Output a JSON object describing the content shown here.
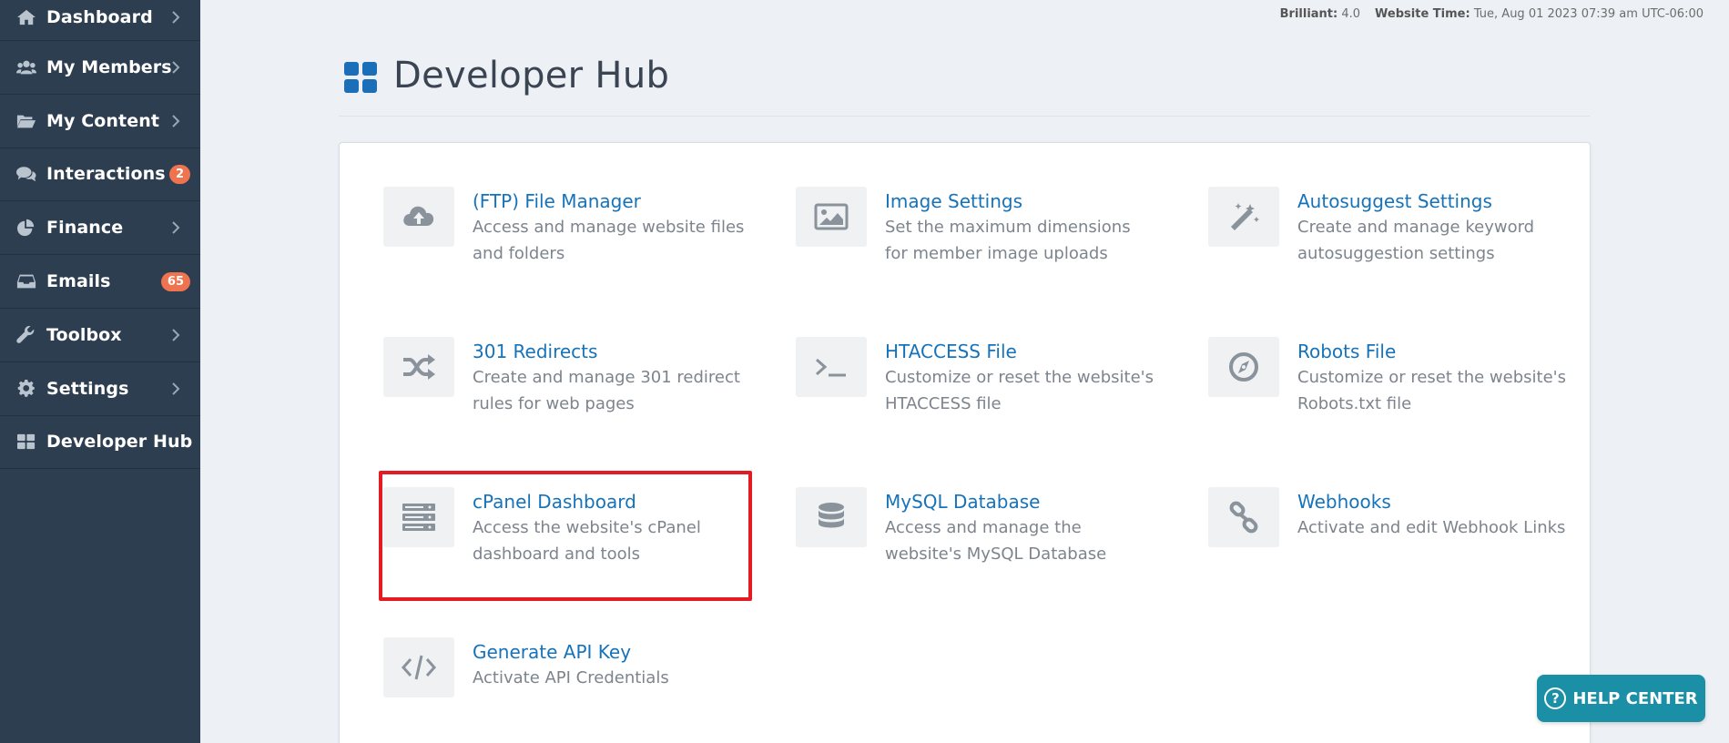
{
  "sidebar": {
    "items": [
      {
        "label": "Dashboard",
        "icon": "home-icon",
        "badge": null,
        "chevron": true
      },
      {
        "label": "My Members",
        "icon": "users-icon",
        "badge": null,
        "chevron": true
      },
      {
        "label": "My Content",
        "icon": "folder-open-icon",
        "badge": null,
        "chevron": true
      },
      {
        "label": "Interactions",
        "icon": "comments-icon",
        "badge": "2",
        "chevron": false
      },
      {
        "label": "Finance",
        "icon": "pie-chart-icon",
        "badge": null,
        "chevron": true
      },
      {
        "label": "Emails",
        "icon": "inbox-icon",
        "badge": "65",
        "chevron": false
      },
      {
        "label": "Toolbox",
        "icon": "wrench-icon",
        "badge": null,
        "chevron": true
      },
      {
        "label": "Settings",
        "icon": "gear-icon",
        "badge": null,
        "chevron": true
      },
      {
        "label": "Developer Hub",
        "icon": "grid-icon",
        "badge": null,
        "chevron": false
      }
    ]
  },
  "status": {
    "version_label": "Brilliant:",
    "version_value": "4.0",
    "time_label": "Website Time:",
    "time_value": "Tue, Aug 01 2023 07:39 am UTC-06:00"
  },
  "page": {
    "title": "Developer Hub"
  },
  "tools": [
    {
      "title": "(FTP) File Manager",
      "desc": "Access and manage website files and folders",
      "icon": "cloud-upload-icon"
    },
    {
      "title": "Image Settings",
      "desc": "Set the maximum dimensions for member image uploads",
      "icon": "image-icon"
    },
    {
      "title": "Autosuggest Settings",
      "desc": "Create and manage keyword autosuggestion settings",
      "icon": "magic-wand-icon"
    },
    {
      "title": "301 Redirects",
      "desc": "Create and manage 301 redirect rules for web pages",
      "icon": "shuffle-icon"
    },
    {
      "title": "HTACCESS File",
      "desc": "Customize or reset the website's HTACCESS file",
      "icon": "terminal-icon"
    },
    {
      "title": "Robots File",
      "desc": "Customize or reset the website's Robots.txt file",
      "icon": "compass-icon"
    },
    {
      "title": "cPanel Dashboard",
      "desc": "Access the website's cPanel dashboard and tools",
      "icon": "server-icon"
    },
    {
      "title": "MySQL Database",
      "desc": "Access and manage the website's MySQL Database",
      "icon": "database-icon"
    },
    {
      "title": "Webhooks",
      "desc": "Activate and edit Webhook Links",
      "icon": "link-icon"
    },
    {
      "title": "Generate API Key",
      "desc": "Activate API Credentials",
      "icon": "code-icon"
    }
  ],
  "help": {
    "label": "HELP CENTER",
    "glyph": "?"
  },
  "colors": {
    "sidebar_bg": "#2d3e50",
    "accent_blue": "#1673b9",
    "badge_orange": "#f0734f",
    "help_teal": "#1a8fa6",
    "highlight_red": "#e41b23"
  }
}
